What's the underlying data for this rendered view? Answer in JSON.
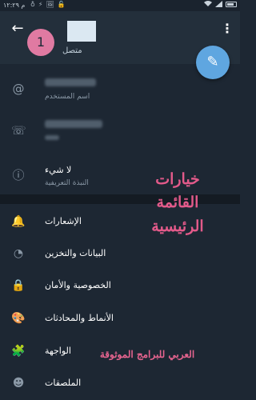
{
  "status_bar": {
    "time": "م ١٢:٢٩",
    "left_icons": [
      "♁",
      "⚡",
      "🖼",
      "🔓"
    ],
    "right_icons": [
      "wifi",
      "signal",
      "battery"
    ]
  },
  "header": {
    "back_icon": "←",
    "more_icon": "⋮",
    "avatar_number": "1",
    "status": "متصل",
    "fab_icon": "✎"
  },
  "info": [
    {
      "icon": "@",
      "icon_name": "at-icon",
      "caption": "اسم المستخدم",
      "value_redacted": true
    },
    {
      "icon": "☏",
      "icon_name": "phone-icon",
      "caption": "",
      "value_redacted": true
    },
    {
      "icon": "ⓘ",
      "icon_name": "info-icon",
      "value": "لا شيء",
      "caption": "النبذة التعريفية"
    }
  ],
  "settings": [
    {
      "icon": "🔔",
      "icon_name": "bell-icon",
      "label": "الإشعارات"
    },
    {
      "icon": "◔",
      "icon_name": "storage-icon",
      "label": "البيانات والتخزين"
    },
    {
      "icon": "🔒",
      "icon_name": "lock-icon",
      "label": "الخصوصية والأمان"
    },
    {
      "icon": "🎨",
      "icon_name": "palette-icon",
      "label": "الأنماط والمحادثات"
    },
    {
      "icon": "🧩",
      "icon_name": "puzzle-icon",
      "label": "الواجهة"
    },
    {
      "icon": "☻",
      "icon_name": "sticker-icon",
      "label": "الملصقات"
    }
  ],
  "annotation": {
    "line1": "خيارات",
    "line2": "القائمة",
    "line3": "الرئيسية",
    "footer": "العربي للبرامج الموثوقة"
  },
  "colors": {
    "background": "#1d2733",
    "header": "#232f3b",
    "accent": "#5fa6e0",
    "annotation": "#e35a8a"
  }
}
